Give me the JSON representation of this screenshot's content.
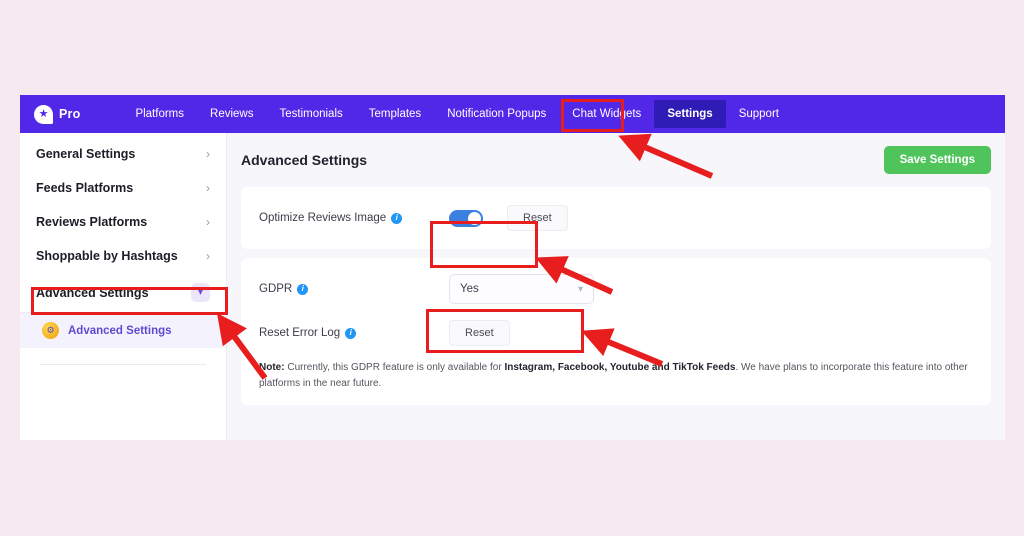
{
  "app": {
    "brand_label": "Pro",
    "brand_icon": "star-bubble-icon"
  },
  "topnav": {
    "items": [
      {
        "label": "Platforms",
        "active": false
      },
      {
        "label": "Reviews",
        "active": false
      },
      {
        "label": "Testimonials",
        "active": false
      },
      {
        "label": "Templates",
        "active": false
      },
      {
        "label": "Notification Popups",
        "active": false
      },
      {
        "label": "Chat Widgets",
        "active": false
      },
      {
        "label": "Settings",
        "active": true
      },
      {
        "label": "Support",
        "active": false
      }
    ]
  },
  "sidebar": {
    "items": [
      {
        "label": "General Settings",
        "icon": "chevron-right-icon"
      },
      {
        "label": "Feeds Platforms",
        "icon": "chevron-right-icon"
      },
      {
        "label": "Reviews Platforms",
        "icon": "chevron-right-icon"
      },
      {
        "label": "Shoppable by Hashtags",
        "icon": "chevron-right-icon"
      },
      {
        "label": "Advanced Settings",
        "icon": "chevron-down-icon"
      }
    ],
    "sub_item": {
      "label": "Advanced Settings",
      "icon": "advanced-settings-badge-icon"
    }
  },
  "main": {
    "page_title": "Advanced Settings",
    "save_label": "Save Settings",
    "optimize": {
      "label": "Optimize Reviews Image",
      "info_icon": "info-icon",
      "toggle_state": "on",
      "reset_label": "Reset"
    },
    "gdpr": {
      "label": "GDPR",
      "info_icon": "info-icon",
      "selected": "Yes",
      "caret_icon": "chevron-down-icon"
    },
    "reset_error_log": {
      "label": "Reset Error Log",
      "info_icon": "info-icon",
      "reset_label": "Reset"
    },
    "note": {
      "prefix": "Note:",
      "text_before": " Currently, this GDPR feature is only available for ",
      "platforms": "Instagram, Facebook, Youtube and TikTok Feeds",
      "text_after": ". We have plans to incorporate this feature into other platforms in the near future."
    }
  },
  "colors": {
    "brand_purple": "#5127e8",
    "active_nav": "#2f1bb5",
    "save_green": "#4fc45a",
    "toggle_blue": "#3b7fe0",
    "annotation_red": "#e81e1e",
    "page_background": "#f6eaf0",
    "sub_item_purple": "#5d4bd0"
  }
}
